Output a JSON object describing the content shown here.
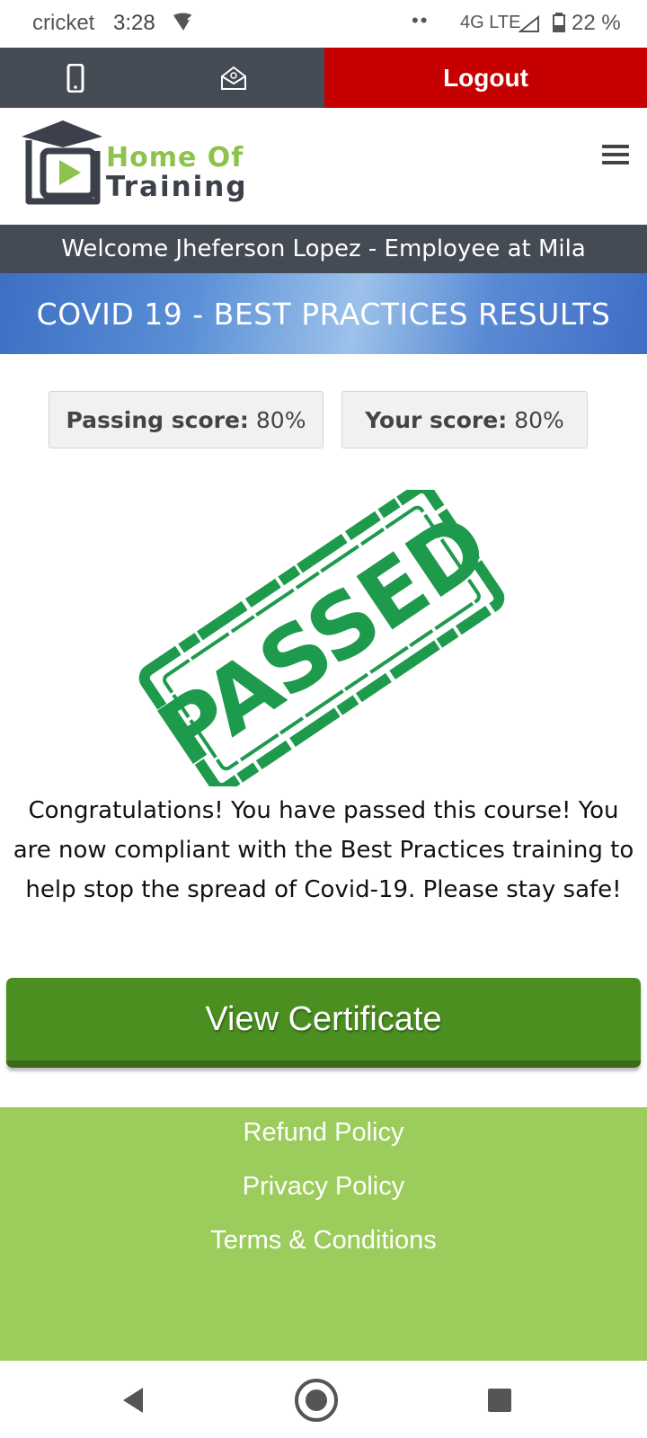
{
  "status_bar": {
    "carrier": "cricket",
    "time": "3:28",
    "dots": "••",
    "network": "4G LTE",
    "battery_percent": "22 %"
  },
  "top_bar": {
    "logout_label": "Logout",
    "colors": {
      "dark": "#454b55",
      "logout": "#c60000"
    }
  },
  "header": {
    "logo_line1": "Home Of",
    "logo_line2": "Training"
  },
  "welcome_text": "Welcome Jheferson Lopez - Employee at Mila",
  "page_title": "COVID 19 - BEST PRACTICES RESULTS",
  "scores": {
    "passing_label": "Passing score:",
    "passing_value": "80%",
    "your_label": "Your score:",
    "your_value": "80%"
  },
  "stamp": {
    "text": "PASSED",
    "color": "#1e9a4c"
  },
  "message": "Congratulations! You have passed this course! You are now compliant with the Best Practices training to help stop the spread of Covid-19. Please stay safe!",
  "certificate_button_label": "View Certificate",
  "footer": {
    "links": [
      "Refund Policy",
      "Privacy Policy",
      "Terms & Conditions"
    ],
    "color": "#9ccc5c"
  }
}
